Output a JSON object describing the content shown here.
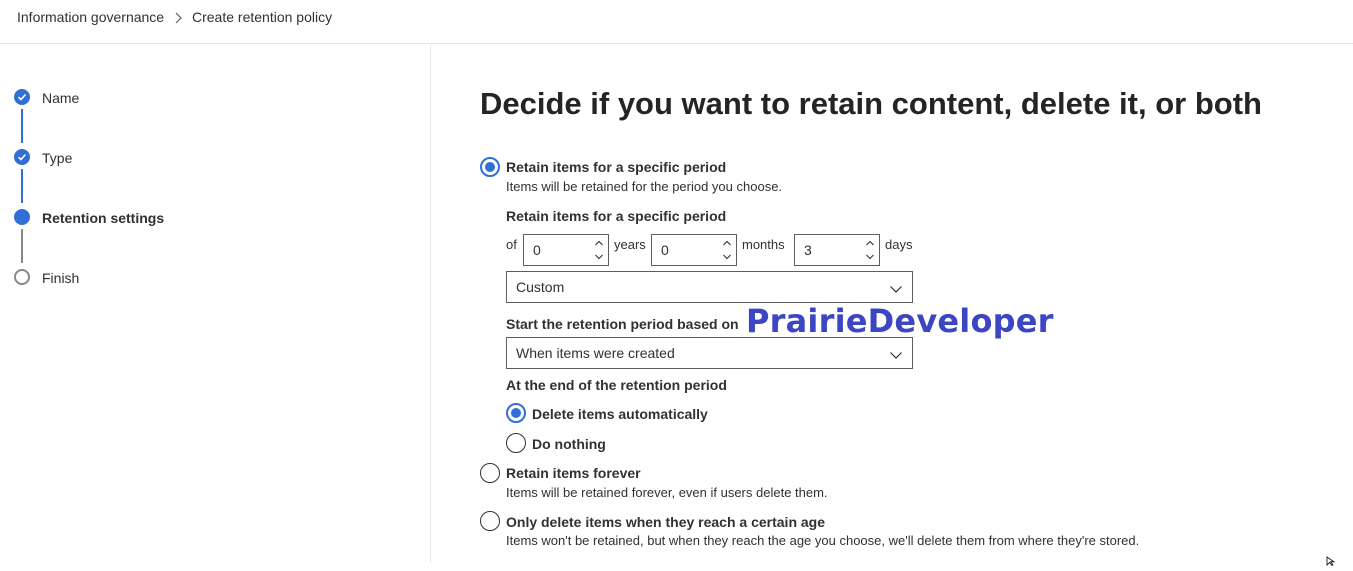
{
  "breadcrumb": {
    "parent": "Information governance",
    "current": "Create retention policy"
  },
  "steps": [
    {
      "label": "Name",
      "state": "done"
    },
    {
      "label": "Type",
      "state": "done"
    },
    {
      "label": "Retention settings",
      "state": "current"
    },
    {
      "label": "Finish",
      "state": "future"
    }
  ],
  "page": {
    "title": "Decide if you want to retain content, delete it, or both"
  },
  "options": {
    "retain_period": {
      "label": "Retain items for a specific period",
      "description": "Items will be retained for the period you choose.",
      "checked": true
    },
    "retain_forever": {
      "label": "Retain items forever",
      "description": "Items will be retained forever, even if users delete them.",
      "checked": false
    },
    "delete_only": {
      "label": "Only delete items when they reach a certain age",
      "description": "Items won't be retained, but when they reach the age you choose, we'll delete them from where they're stored.",
      "checked": false
    }
  },
  "period": {
    "label": "Retain items for a specific period",
    "of_text": "of",
    "years_value": "0",
    "years_unit": "years",
    "months_value": "0",
    "months_unit": "months",
    "days_value": "3",
    "days_unit": "days",
    "preset": "Custom"
  },
  "start_based_on": {
    "label": "Start the retention period based on",
    "value": "When items were created"
  },
  "end_action": {
    "label": "At the end of the retention period",
    "delete_label": "Delete items automatically",
    "delete_checked": true,
    "nothing_label": "Do nothing",
    "nothing_checked": false
  },
  "watermark": "PrairieDeveloper",
  "colors": {
    "accent": "#2f6fd6",
    "watermark": "#3c46c4",
    "step_line_done": "#2f6fd6",
    "step_line_future": "#8a8886"
  }
}
